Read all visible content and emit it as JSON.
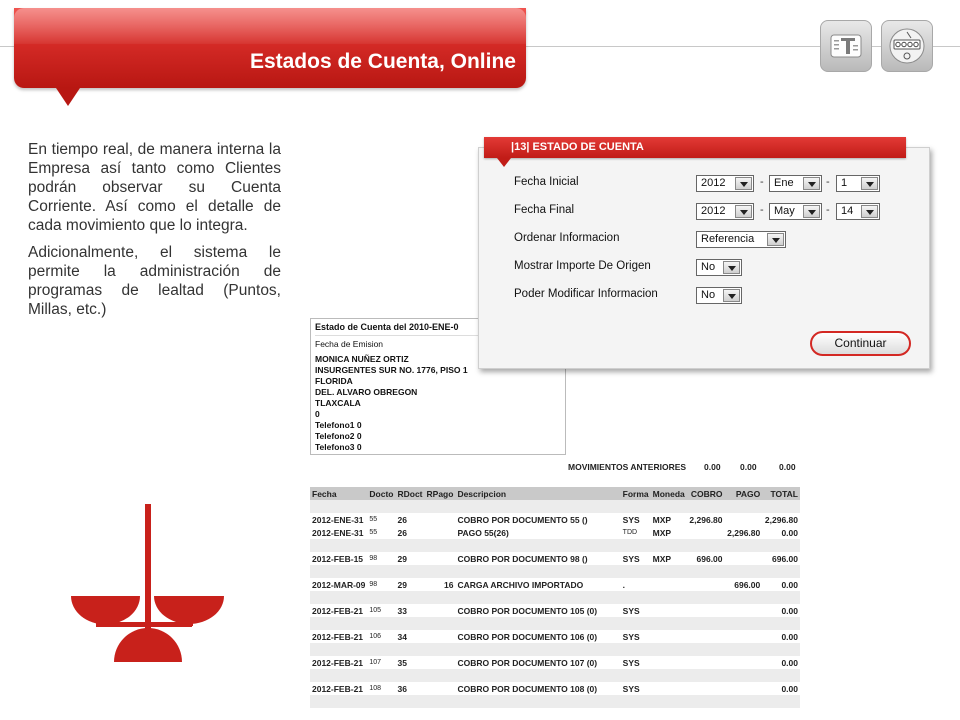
{
  "header": {
    "title": "Estados de Cuenta, Online",
    "icons": [
      "ticket-icon",
      "register-icon"
    ]
  },
  "intro": {
    "p1": "En tiempo real, de manera interna la Empresa así tanto como Clientes podrán observar su Cuenta Corriente. Así como el detalle de cada movimiento que lo integra.",
    "p2": "Adicionalmente, el sistema le permite la administración de programas de lealtad (Puntos, Millas, etc.)"
  },
  "dialog": {
    "banner": "|13|   ESTADO DE CUENTA",
    "fields": {
      "fecha_inicial": {
        "label": "Fecha Inicial",
        "year": "2012",
        "month": "Ene",
        "day": "1"
      },
      "fecha_final": {
        "label": "Fecha Final",
        "year": "2012",
        "month": "May",
        "day": "14"
      },
      "ordenar": {
        "label": "Ordenar Informacion",
        "value": "Referencia"
      },
      "importe_origen": {
        "label": "Mostrar Importe De Origen",
        "value": "No"
      },
      "modificar": {
        "label": "Poder Modificar Informacion",
        "value": "No"
      }
    },
    "separator": "-",
    "continue_label": "Continuar"
  },
  "statement": {
    "title": "Estado de Cuenta del 2010-ENE-0",
    "subtitle": "Fecha de Emision",
    "lines": [
      "MONICA NUÑEZ ORTIZ",
      "INSURGENTES SUR NO. 1776, PISO 1",
      "FLORIDA",
      "DEL. ALVARO OBREGON",
      "TLAXCALA",
      "0",
      "Telefono1 0",
      "Telefono2 0",
      "Telefono3 0"
    ],
    "previous": {
      "label": "MOVIMIENTOS ANTERIORES",
      "cobro": "0.00",
      "pago": "0.00",
      "total": "0.00"
    },
    "columns": [
      "Fecha",
      "Docto",
      "RDoct",
      "RPago",
      "Descripcion",
      "Forma",
      "Moneda",
      "COBRO",
      "PAGO",
      "TOTAL"
    ],
    "rows": [
      {
        "fecha": "2012-ENE-31",
        "docto": "55",
        "rdoct": "26",
        "rpago": "",
        "desc": "COBRO POR DOCUMENTO 55 ()",
        "forma": "SYS",
        "moneda": "MXP",
        "cobro": "2,296.80",
        "pago": "",
        "total": "2,296.80"
      },
      {
        "fecha": "2012-ENE-31",
        "docto": "55",
        "rdoct": "26",
        "rpago": "",
        "desc": "PAGO 55(26)",
        "forma": "TDD",
        "moneda": "MXP",
        "cobro": "",
        "pago": "2,296.80",
        "total": "0.00"
      },
      {
        "fecha": "2012-FEB-15",
        "docto": "98",
        "rdoct": "29",
        "rpago": "",
        "desc": "COBRO POR DOCUMENTO 98 ()",
        "forma": "SYS",
        "moneda": "MXP",
        "cobro": "696.00",
        "pago": "",
        "total": "696.00"
      },
      {
        "fecha": "2012-MAR-09",
        "docto": "98",
        "rdoct": "29",
        "rpago": "16",
        "desc": "CARGA ARCHIVO IMPORTADO",
        "forma": ".",
        "moneda": "",
        "cobro": "",
        "pago": "696.00",
        "total": "0.00"
      },
      {
        "fecha": "2012-FEB-21",
        "docto": "105",
        "rdoct": "33",
        "rpago": "",
        "desc": "COBRO POR DOCUMENTO 105 (0)",
        "forma": "SYS",
        "moneda": "",
        "cobro": "",
        "pago": "",
        "total": "0.00"
      },
      {
        "fecha": "2012-FEB-21",
        "docto": "106",
        "rdoct": "34",
        "rpago": "",
        "desc": "COBRO POR DOCUMENTO 106 (0)",
        "forma": "SYS",
        "moneda": "",
        "cobro": "",
        "pago": "",
        "total": "0.00"
      },
      {
        "fecha": "2012-FEB-21",
        "docto": "107",
        "rdoct": "35",
        "rpago": "",
        "desc": "COBRO POR DOCUMENTO 107 (0)",
        "forma": "SYS",
        "moneda": "",
        "cobro": "",
        "pago": "",
        "total": "0.00"
      },
      {
        "fecha": "2012-FEB-21",
        "docto": "108",
        "rdoct": "36",
        "rpago": "",
        "desc": "COBRO POR DOCUMENTO 108 (0)",
        "forma": "SYS",
        "moneda": "",
        "cobro": "",
        "pago": "",
        "total": "0.00"
      }
    ]
  },
  "colors": {
    "brand_red": "#d42a26",
    "header_gray": "#c9c9c9"
  }
}
